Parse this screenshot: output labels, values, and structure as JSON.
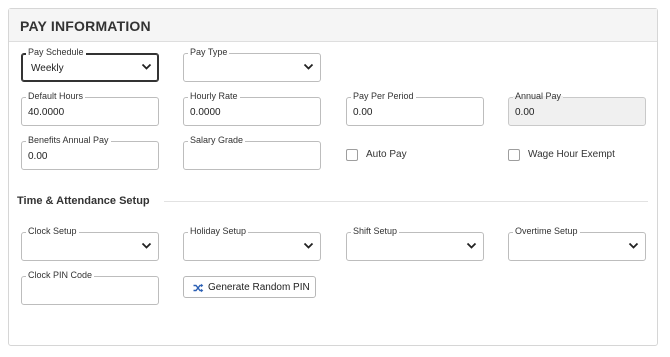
{
  "panel": {
    "title": "PAY INFORMATION"
  },
  "pay_schedule": {
    "label": "Pay Schedule",
    "value": "Weekly"
  },
  "pay_type": {
    "label": "Pay Type",
    "value": ""
  },
  "default_hours": {
    "label": "Default Hours",
    "value": "40.0000"
  },
  "hourly_rate": {
    "label": "Hourly Rate",
    "value": "0.0000"
  },
  "pay_per_period": {
    "label": "Pay Per Period",
    "value": "0.00"
  },
  "annual_pay": {
    "label": "Annual Pay",
    "value": "0.00"
  },
  "benefits_annual_pay": {
    "label": "Benefits Annual Pay",
    "value": "0.00"
  },
  "salary_grade": {
    "label": "Salary Grade",
    "value": ""
  },
  "auto_pay": {
    "label": "Auto Pay",
    "checked": false
  },
  "wage_hour_exempt": {
    "label": "Wage Hour Exempt",
    "checked": false
  },
  "time_attendance": {
    "title": "Time & Attendance Setup",
    "clock_setup": {
      "label": "Clock Setup",
      "value": ""
    },
    "holiday_setup": {
      "label": "Holiday Setup",
      "value": ""
    },
    "shift_setup": {
      "label": "Shift Setup",
      "value": ""
    },
    "overtime_setup": {
      "label": "Overtime Setup",
      "value": ""
    },
    "clock_pin_code": {
      "label": "Clock PIN Code",
      "value": ""
    },
    "generate_pin_button": {
      "label": "Generate Random PIN",
      "icon": "shuffle-icon",
      "icon_color": "#2b5fb4"
    }
  }
}
